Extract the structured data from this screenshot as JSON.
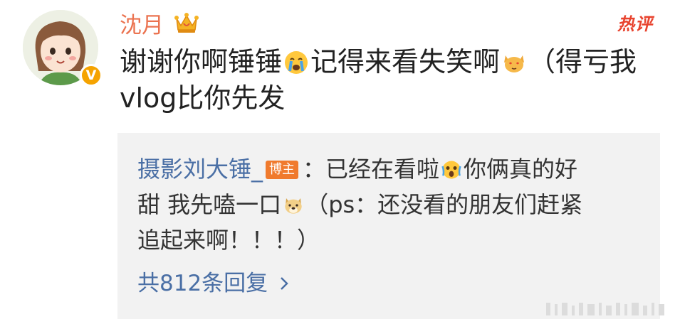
{
  "comment": {
    "username": "沈月",
    "hot_label": "热评",
    "line1_a": "谢谢你啊锤锤",
    "line1_b": "记得来看失笑啊",
    "line1_c": "（得亏我",
    "line2": "vlog比你先发",
    "emoji_crying": "crying-face-emoji",
    "emoji_cat": "hearts-cat-emoji"
  },
  "reply": {
    "author": "摄影刘大锤_",
    "host_badge": "博主",
    "line1_a": "：已经在看啦",
    "line1_b": "你俩真的好",
    "line2_a": "甜 我先嗑一口",
    "line2_b": "（ps：还没看的朋友们赶紧",
    "line3": "追起来啊！！！）",
    "more_replies": "共812条回复"
  },
  "colors": {
    "username": "#eb7350",
    "link": "#4a6fa5",
    "hot": "#e8432e",
    "host_badge": "#f07a2d",
    "v_badge": "#f5a300",
    "reply_bg": "#f2f2f2"
  }
}
